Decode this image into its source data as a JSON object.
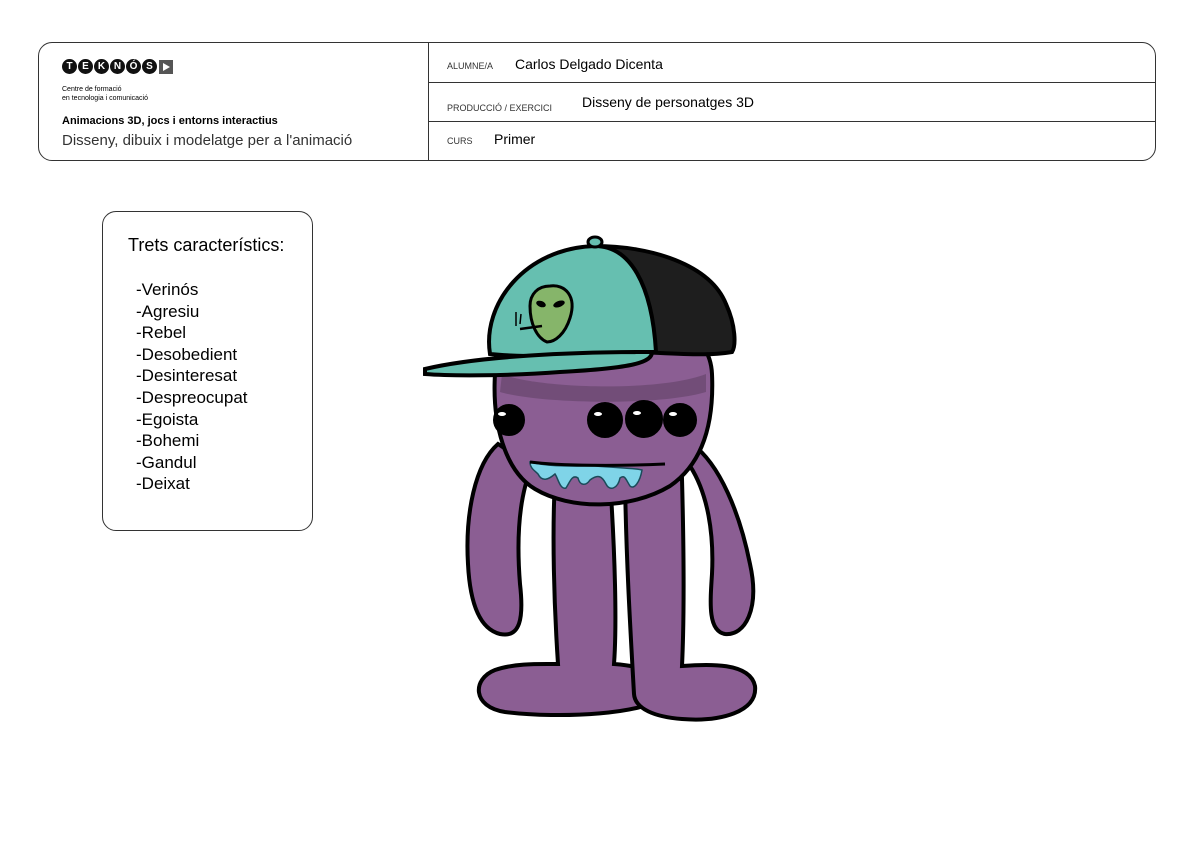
{
  "header": {
    "logo_letters": [
      "T",
      "E",
      "K",
      "N",
      "Ó",
      "S"
    ],
    "centre_line1": "Centre de formació",
    "centre_line2": "en tecnologia i comunicació",
    "program": "Animacions 3D, jocs i entorns interactius",
    "course_title": "Disseny, dibuix i modelatge per a l'animació",
    "student_label": "ALUMNE/A",
    "student_value": "Carlos Delgado Dicenta",
    "production_label": "PRODUCCIÓ / EXERCICI",
    "production_value": "Disseny de personatges 3D",
    "curs_label": "CURS",
    "curs_value": "Primer"
  },
  "traits": {
    "title": "Trets característics:",
    "items": [
      "-Verinós",
      "-Agresiu",
      "-Rebel",
      "-Desobedient",
      "-Desinteresat",
      "-Despreocupat",
      "-Egoista",
      "-Bohemi",
      "-Gandul",
      "-Deixat"
    ]
  },
  "colors": {
    "body": "#8b5e93",
    "cap": "#66bfb0",
    "cap_back": "#1e1e1e",
    "alien": "#86b56a",
    "drool": "#7fd4e8"
  },
  "character_icon": "purple-monster-with-cap"
}
